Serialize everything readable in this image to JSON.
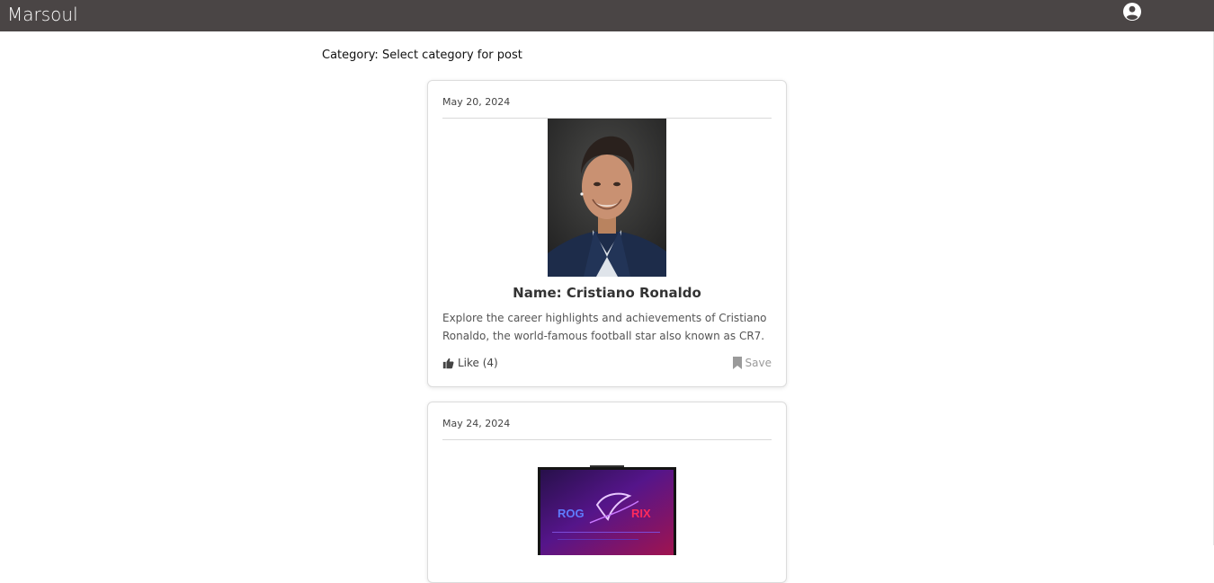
{
  "header": {
    "brand": "Marsoul",
    "account_icon": "user-circle-icon"
  },
  "filter": {
    "category_text": "Category: Select category for post"
  },
  "posts": [
    {
      "date": "May 20, 2024",
      "image_icon": "person-photo",
      "name": "Name: Cristiano Ronaldo",
      "description": "Explore the career highlights and achievements of Cristiano Ronaldo, the world-famous football star also known as CR7.",
      "like_label": "Like (4)",
      "like_icon": "thumbs-up-icon",
      "save_label": "Save",
      "save_icon": "bookmark-icon"
    },
    {
      "date": "May 24, 2024",
      "image_icon": "laptop-photo"
    }
  ],
  "colors": {
    "topbar": "#4a4545",
    "card_border": "#dcdcdc",
    "save_text": "#9a9a9a"
  }
}
